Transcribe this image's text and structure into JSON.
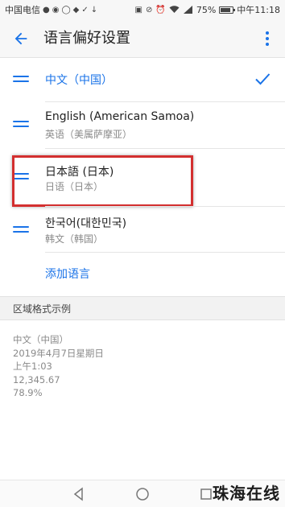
{
  "status_bar": {
    "carrier": "中国电信",
    "battery_percent": "75%",
    "battery_level": 0.75,
    "time": "中午11:18",
    "left_icons": [
      "chat-icon",
      "qq-icon",
      "browser-icon",
      "app-icon",
      "signal-icon",
      "download-icon"
    ],
    "right_icons": [
      "nfc-icon",
      "mute-icon",
      "alarm-icon",
      "wifi-icon",
      "signal-4g-icon",
      "battery-icon"
    ]
  },
  "app_bar": {
    "title": "语言偏好设置",
    "back_icon": "arrow-left-icon",
    "more_icon": "more-vert-icon"
  },
  "languages": [
    {
      "name": "中文（中国）",
      "subtitle": "",
      "active": true
    },
    {
      "name": "English (American Samoa)",
      "subtitle": "英语（美属萨摩亚）",
      "active": false
    },
    {
      "name": "日本語 (日本)",
      "subtitle": "日语（日本）",
      "active": false,
      "highlighted": true
    },
    {
      "name": "한국어(대한민국)",
      "subtitle": "韩文（韩国）",
      "active": false
    }
  ],
  "add_language_label": "添加语言",
  "region": {
    "section_title": "区域格式示例",
    "lines": [
      "中文（中国）",
      "2019年4月7日星期日",
      "上午1:03",
      "12,345.67",
      "78.9%"
    ]
  },
  "nav_bar": {
    "icons": [
      "back-triangle-icon",
      "home-circle-icon",
      "recents-square-icon"
    ]
  },
  "watermark": "珠海在线",
  "colors": {
    "accent": "#1a73e8",
    "highlight_border": "#d32f2f",
    "subtitle_text": "#8a8a8a"
  }
}
